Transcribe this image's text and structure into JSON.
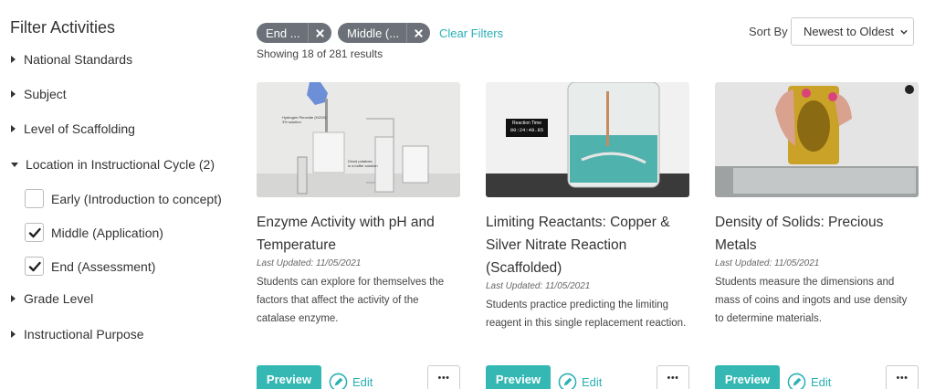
{
  "sidebar": {
    "title": "Filter Activities",
    "filters": [
      {
        "label": "National Standards"
      },
      {
        "label": "Subject"
      },
      {
        "label": "Level of Scaffolding"
      },
      {
        "label": "Location in Instructional Cycle (2)",
        "expanded": true
      },
      {
        "label": "Grade Level"
      },
      {
        "label": "Instructional Purpose"
      }
    ],
    "options": [
      {
        "label": "Early (Introduction to concept)",
        "checked": false
      },
      {
        "label": "Middle (Application)",
        "checked": true
      },
      {
        "label": "End (Assessment)",
        "checked": true
      }
    ]
  },
  "active_filters": [
    {
      "label": "End ..."
    },
    {
      "label": "Middle (..."
    }
  ],
  "clear_filters": "Clear Filters",
  "results": "Showing 18 of 281 results",
  "sort": {
    "label": "Sort By",
    "value": "Newest to Oldest"
  },
  "cards": [
    {
      "title": "Enzyme Activity with pH and Temperature",
      "date": "Last Updated: 11/05/2021",
      "description": "Students can explore for themselves the factors that affect the activity of the catalase enzyme.",
      "preview": "Preview",
      "edit": "Edit",
      "more": "•••"
    },
    {
      "title": "Limiting Reactants: Copper & Silver Nitrate Reaction (Scaffolded)",
      "date": "Last Updated: 11/05/2021",
      "description": "Students practice predicting the limiting reagent in this single replacement reaction.",
      "timer_label": "Reaction Time",
      "timer_value": "00:24:48.85",
      "preview": "Preview",
      "edit": "Edit",
      "more": "•••"
    },
    {
      "title": "Density of Solids: Precious Metals",
      "date": "Last Updated: 11/05/2021",
      "description": "Students measure the dimensions and mass of coins and ingots and use density to determine materials.",
      "preview": "Preview",
      "edit": "Edit",
      "more": "•••"
    }
  ],
  "colors": {
    "accent": "#35b8b3",
    "chip": "#6b7079",
    "link": "#2ab0b4"
  }
}
